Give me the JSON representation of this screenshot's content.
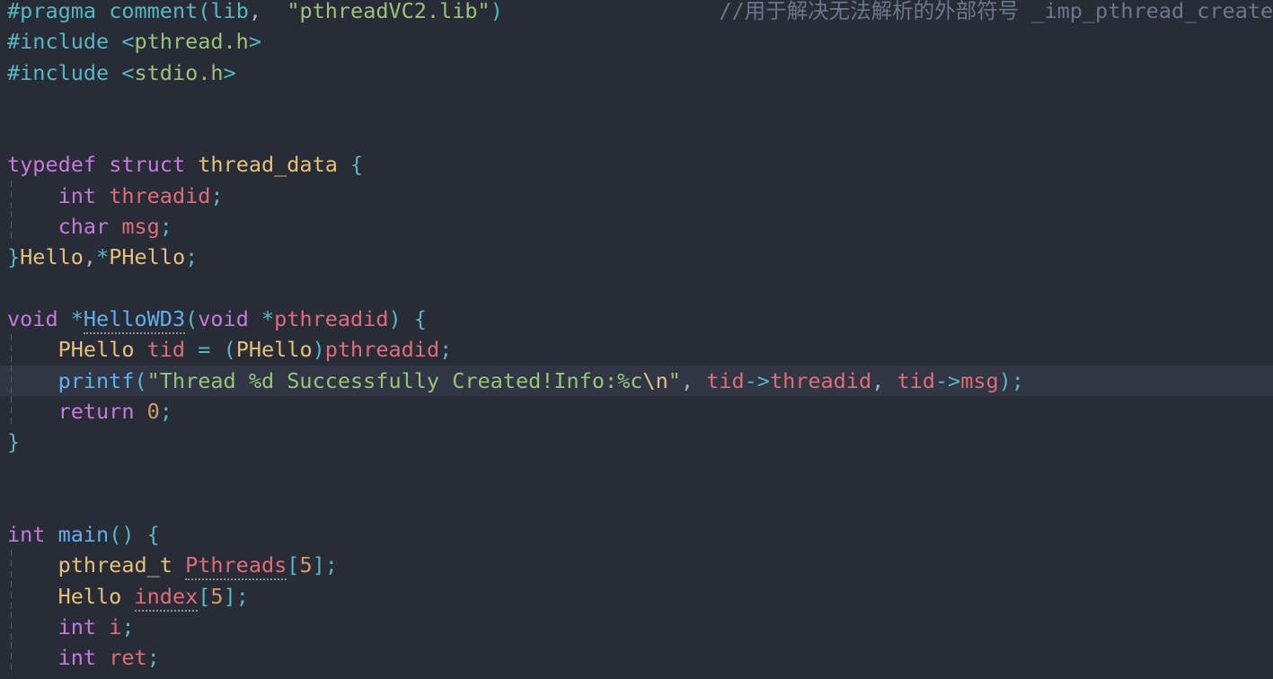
{
  "editor": {
    "language": "C",
    "background_color": "#282c37",
    "current_line_color": "#313644",
    "indent_guide_color": "#555d6c",
    "palette": {
      "preprocessor": "#56b6c2",
      "keyword": "#c678dd",
      "type": "#e5c07b",
      "variable": "#e06c75",
      "function": "#61afef",
      "string": "#98c379",
      "escape": "#e5c07b",
      "number": "#d19a66",
      "punctuation": "#56b6c2",
      "comment": "#6d7689"
    }
  },
  "lines": [
    {
      "n": 1,
      "current": false,
      "guide": false,
      "tokens": [
        {
          "t": "#pragma",
          "c": "pre"
        },
        {
          "t": " ",
          "c": "plain"
        },
        {
          "t": "comment",
          "c": "pre"
        },
        {
          "t": "(",
          "c": "punct"
        },
        {
          "t": "lib",
          "c": "pre"
        },
        {
          "t": ",",
          "c": "plain"
        },
        {
          "t": "  ",
          "c": "plain"
        },
        {
          "t": "\"pthreadVC2.lib\"",
          "c": "string"
        },
        {
          "t": ")",
          "c": "punct"
        },
        {
          "t": "                 ",
          "c": "plain"
        },
        {
          "t": "//用于解决无法解析的外部符号 _imp_pthread_create问题",
          "c": "comment"
        }
      ]
    },
    {
      "n": 2,
      "current": false,
      "guide": false,
      "tokens": [
        {
          "t": "#include",
          "c": "pre"
        },
        {
          "t": " ",
          "c": "plain"
        },
        {
          "t": "<",
          "c": "punct"
        },
        {
          "t": "pthread.h",
          "c": "string"
        },
        {
          "t": ">",
          "c": "punct"
        }
      ]
    },
    {
      "n": 3,
      "current": false,
      "guide": false,
      "tokens": [
        {
          "t": "#include",
          "c": "pre"
        },
        {
          "t": " ",
          "c": "plain"
        },
        {
          "t": "<",
          "c": "punct"
        },
        {
          "t": "stdio.h",
          "c": "string"
        },
        {
          "t": ">",
          "c": "punct"
        }
      ]
    },
    {
      "n": 4,
      "current": false,
      "guide": false,
      "tokens": []
    },
    {
      "n": 5,
      "current": false,
      "guide": false,
      "tokens": []
    },
    {
      "n": 6,
      "current": false,
      "guide": false,
      "tokens": [
        {
          "t": "typedef",
          "c": "keyword"
        },
        {
          "t": " ",
          "c": "plain"
        },
        {
          "t": "struct",
          "c": "keyword"
        },
        {
          "t": " ",
          "c": "plain"
        },
        {
          "t": "thread_data",
          "c": "type"
        },
        {
          "t": " ",
          "c": "plain"
        },
        {
          "t": "{",
          "c": "punct"
        }
      ]
    },
    {
      "n": 7,
      "current": false,
      "guide": true,
      "tokens": [
        {
          "t": "    ",
          "c": "plain"
        },
        {
          "t": "int",
          "c": "keyword"
        },
        {
          "t": " ",
          "c": "plain"
        },
        {
          "t": "threadid",
          "c": "var"
        },
        {
          "t": ";",
          "c": "punct"
        }
      ]
    },
    {
      "n": 8,
      "current": false,
      "guide": true,
      "tokens": [
        {
          "t": "    ",
          "c": "plain"
        },
        {
          "t": "char",
          "c": "keyword"
        },
        {
          "t": " ",
          "c": "plain"
        },
        {
          "t": "msg",
          "c": "var"
        },
        {
          "t": ";",
          "c": "punct"
        }
      ]
    },
    {
      "n": 9,
      "current": false,
      "guide": false,
      "tokens": [
        {
          "t": "}",
          "c": "punct"
        },
        {
          "t": "Hello",
          "c": "type"
        },
        {
          "t": ",",
          "c": "plain"
        },
        {
          "t": "*",
          "c": "punct"
        },
        {
          "t": "PHello",
          "c": "type"
        },
        {
          "t": ";",
          "c": "punct"
        }
      ]
    },
    {
      "n": 10,
      "current": false,
      "guide": false,
      "tokens": []
    },
    {
      "n": 11,
      "current": false,
      "guide": false,
      "tokens": [
        {
          "t": "void",
          "c": "keyword"
        },
        {
          "t": " ",
          "c": "plain"
        },
        {
          "t": "*",
          "c": "punct"
        },
        {
          "t": "HelloWD3",
          "c": "func",
          "squiggle": true
        },
        {
          "t": "(",
          "c": "punct"
        },
        {
          "t": "void",
          "c": "keyword"
        },
        {
          "t": " ",
          "c": "plain"
        },
        {
          "t": "*",
          "c": "punct"
        },
        {
          "t": "pthreadid",
          "c": "var"
        },
        {
          "t": ")",
          "c": "punct"
        },
        {
          "t": " ",
          "c": "plain"
        },
        {
          "t": "{",
          "c": "punct"
        }
      ]
    },
    {
      "n": 12,
      "current": false,
      "guide": true,
      "tokens": [
        {
          "t": "    ",
          "c": "plain"
        },
        {
          "t": "PHello",
          "c": "type"
        },
        {
          "t": " ",
          "c": "plain"
        },
        {
          "t": "tid",
          "c": "var"
        },
        {
          "t": " ",
          "c": "plain"
        },
        {
          "t": "=",
          "c": "op"
        },
        {
          "t": " ",
          "c": "plain"
        },
        {
          "t": "(",
          "c": "punct"
        },
        {
          "t": "PHello",
          "c": "type"
        },
        {
          "t": ")",
          "c": "punct"
        },
        {
          "t": "pthreadid",
          "c": "var"
        },
        {
          "t": ";",
          "c": "punct"
        }
      ]
    },
    {
      "n": 13,
      "current": true,
      "guide": true,
      "tokens": [
        {
          "t": "    ",
          "c": "plain"
        },
        {
          "t": "printf",
          "c": "func"
        },
        {
          "t": "(",
          "c": "punct"
        },
        {
          "t": "\"Thread %d Successfully Created!Info:%c",
          "c": "string"
        },
        {
          "t": "\\n",
          "c": "escape"
        },
        {
          "t": "\"",
          "c": "string"
        },
        {
          "t": ",",
          "c": "plain"
        },
        {
          "t": " ",
          "c": "plain"
        },
        {
          "t": "tid",
          "c": "var"
        },
        {
          "t": "->",
          "c": "op"
        },
        {
          "t": "threadid",
          "c": "var"
        },
        {
          "t": ",",
          "c": "plain"
        },
        {
          "t": " ",
          "c": "plain"
        },
        {
          "t": "tid",
          "c": "var"
        },
        {
          "t": "->",
          "c": "op"
        },
        {
          "t": "msg",
          "c": "var"
        },
        {
          "t": ")",
          "c": "punct"
        },
        {
          "t": ";",
          "c": "punct"
        }
      ]
    },
    {
      "n": 14,
      "current": false,
      "guide": true,
      "tokens": [
        {
          "t": "    ",
          "c": "plain"
        },
        {
          "t": "return",
          "c": "keyword"
        },
        {
          "t": " ",
          "c": "plain"
        },
        {
          "t": "0",
          "c": "number"
        },
        {
          "t": ";",
          "c": "punct"
        }
      ]
    },
    {
      "n": 15,
      "current": false,
      "guide": false,
      "tokens": [
        {
          "t": "}",
          "c": "punct"
        }
      ]
    },
    {
      "n": 16,
      "current": false,
      "guide": false,
      "tokens": []
    },
    {
      "n": 17,
      "current": false,
      "guide": false,
      "tokens": []
    },
    {
      "n": 18,
      "current": false,
      "guide": false,
      "tokens": [
        {
          "t": "int",
          "c": "keyword"
        },
        {
          "t": " ",
          "c": "plain"
        },
        {
          "t": "main",
          "c": "func"
        },
        {
          "t": "()",
          "c": "punct"
        },
        {
          "t": " ",
          "c": "plain"
        },
        {
          "t": "{",
          "c": "punct"
        }
      ]
    },
    {
      "n": 19,
      "current": false,
      "guide": true,
      "tokens": [
        {
          "t": "    ",
          "c": "plain"
        },
        {
          "t": "pthread_t",
          "c": "type"
        },
        {
          "t": " ",
          "c": "plain"
        },
        {
          "t": "Pthreads",
          "c": "var",
          "squiggle": true
        },
        {
          "t": "[",
          "c": "punct"
        },
        {
          "t": "5",
          "c": "number"
        },
        {
          "t": "]",
          "c": "punct"
        },
        {
          "t": ";",
          "c": "punct"
        }
      ]
    },
    {
      "n": 20,
      "current": false,
      "guide": true,
      "tokens": [
        {
          "t": "    ",
          "c": "plain"
        },
        {
          "t": "Hello",
          "c": "type"
        },
        {
          "t": " ",
          "c": "plain"
        },
        {
          "t": "index",
          "c": "var",
          "squiggle": true
        },
        {
          "t": "[",
          "c": "punct"
        },
        {
          "t": "5",
          "c": "number"
        },
        {
          "t": "]",
          "c": "punct"
        },
        {
          "t": ";",
          "c": "punct"
        }
      ]
    },
    {
      "n": 21,
      "current": false,
      "guide": true,
      "tokens": [
        {
          "t": "    ",
          "c": "plain"
        },
        {
          "t": "int",
          "c": "keyword"
        },
        {
          "t": " ",
          "c": "plain"
        },
        {
          "t": "i",
          "c": "var"
        },
        {
          "t": ";",
          "c": "punct"
        }
      ]
    },
    {
      "n": 22,
      "current": false,
      "guide": true,
      "tokens": [
        {
          "t": "    ",
          "c": "plain"
        },
        {
          "t": "int",
          "c": "keyword"
        },
        {
          "t": " ",
          "c": "plain"
        },
        {
          "t": "ret",
          "c": "var"
        },
        {
          "t": ";",
          "c": "punct"
        }
      ]
    }
  ]
}
